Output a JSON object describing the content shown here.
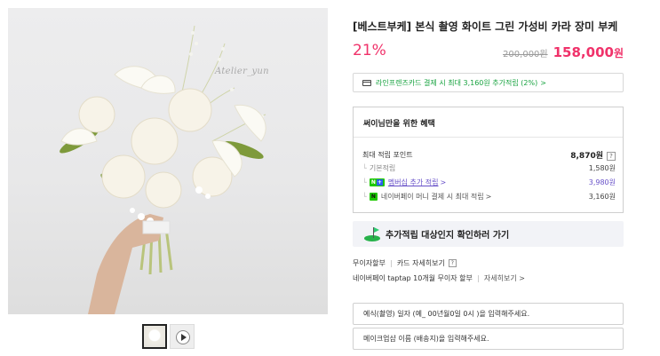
{
  "gallery": {
    "watermark": "Atelier_yun",
    "thumbnails": [
      {
        "type": "image",
        "selected": true,
        "icon": "bouquet-thumbnail"
      },
      {
        "type": "video",
        "selected": false,
        "icon": "play-icon"
      }
    ]
  },
  "product": {
    "title": "[베스트부케] 본식 촬영 화이트 그린 가성비 카라 장미 부케",
    "discount": "21%",
    "original_price": "200,000",
    "original_unit": "원",
    "price": "158,000",
    "price_unit": "원"
  },
  "card_promo": {
    "text": "라인프렌즈카드 결제 시 최대 3,160원 추가적립 (2%)",
    "chevron": ">",
    "icon": "credit-card-icon"
  },
  "benefits": {
    "heading": "써이님만을 위한 혜택",
    "max_points_label": "최대 적립 포인트",
    "max_points_value": "8,870원",
    "help": "?",
    "items": [
      {
        "label": "기본적립",
        "value": "1,580원"
      },
      {
        "badge": "N+",
        "label": "멤버십 추가 적립",
        "chevron": ">",
        "value": "3,980원"
      },
      {
        "badge": "N",
        "label": "네이버페이 머니 결제 시 최대 적립",
        "chevron": ">",
        "value": "3,160원"
      }
    ],
    "tree": "└"
  },
  "check_banner": {
    "text": "추가적립 대상인지 확인하러 가기",
    "icon": "golf-flag-icon"
  },
  "installment": {
    "label1": "무이자할부",
    "label2": "카드 자세히보기",
    "help": "?",
    "line2": "네이버페이 taptap 10개월 무이자 할부",
    "more": "자세히보기 >"
  },
  "form": {
    "field1_placeholder": "예식(촬영) 일자 (예_ 00년월0일 0시 )을 입력해주세요.",
    "field2_placeholder": "메이크업샵 이름 (배송지)을 입력해주세요."
  },
  "colors": {
    "accent": "#f0326a",
    "green": "#18a340",
    "naver_green": "#1ec800",
    "link_purple": "#6750c8"
  }
}
